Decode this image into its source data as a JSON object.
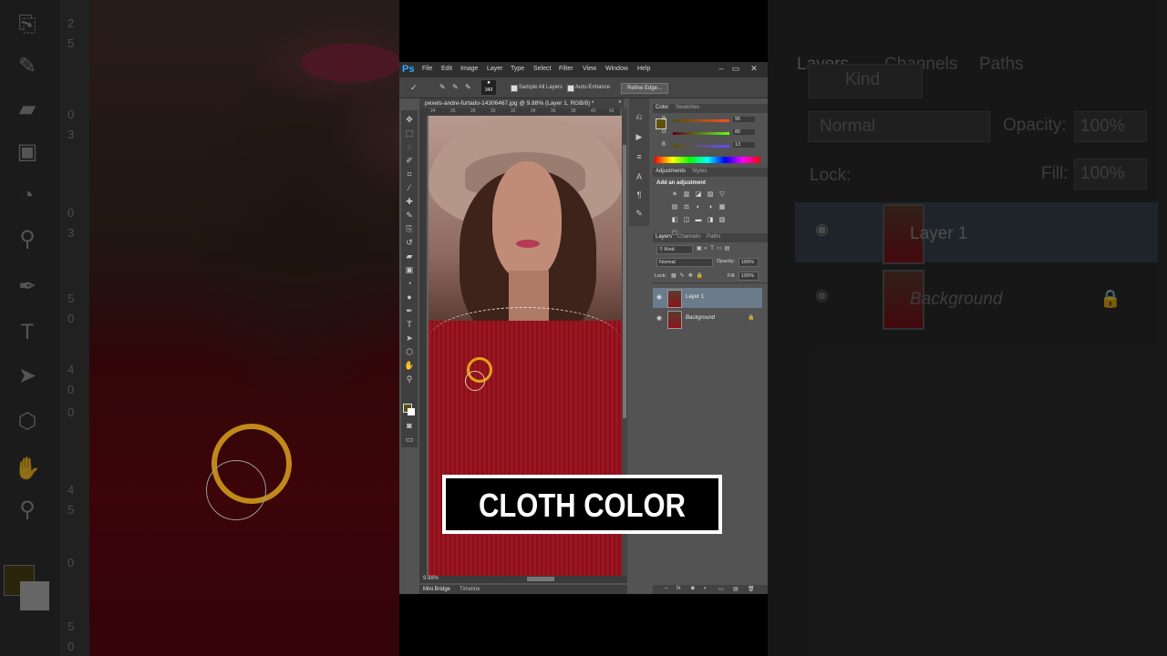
{
  "window": {
    "app_logo": "Ps",
    "menu": [
      "File",
      "Edit",
      "Image",
      "Layer",
      "Type",
      "Select",
      "Filter",
      "View",
      "Window",
      "Help"
    ]
  },
  "options_bar": {
    "brush_size": "343",
    "sample_all_layers": "Sample All Layers",
    "auto_enhance": "Auto-Enhance",
    "refine_edge": "Refine Edge..."
  },
  "document": {
    "tab_title": "pexels-andre-furtado-14306467.jpg @ 9.88% (Layer 1, RGB/8) *",
    "close": "×",
    "ruler_ticks": [
      "24",
      "26",
      "28",
      "30",
      "32",
      "34",
      "36",
      "38",
      "40",
      "42"
    ],
    "zoom": "9.88%"
  },
  "bottom_tabs": {
    "mini_bridge": "Mini Bridge",
    "timeline": "Timeline"
  },
  "color_panel": {
    "tabs": [
      "Color",
      "Swatches"
    ],
    "channels": [
      {
        "label": "R",
        "value": "95",
        "gradient": "linear-gradient(90deg,#505018,#ff5018)"
      },
      {
        "label": "G",
        "value": "80",
        "gradient": "linear-gradient(90deg,#5f0018,#5fff18)"
      },
      {
        "label": "B",
        "value": "13",
        "gradient": "linear-gradient(90deg,#5f5000,#5f50ff)"
      }
    ],
    "foreground": "#5f500d"
  },
  "adjustments_panel": {
    "tabs": [
      "Adjustments",
      "Styles"
    ],
    "heading": "Add an adjustment",
    "icons": [
      "☀",
      "▥",
      "◪",
      "▨",
      "▽",
      "▤",
      "⚖",
      "◐",
      "◑",
      "▦",
      "◧",
      "◫",
      "▬",
      "◨",
      "▧",
      "◻"
    ]
  },
  "layers_panel": {
    "tabs": [
      "Layers",
      "Channels",
      "Paths"
    ],
    "kind": "Kind",
    "blend_mode": "Normal",
    "opacity_label": "Opacity:",
    "opacity": "100%",
    "lock_label": "Lock:",
    "fill_label": "Fill:",
    "fill": "100%",
    "layers": [
      {
        "name": "Layer 1",
        "selected": true
      },
      {
        "name": "Background",
        "selected": false
      }
    ],
    "footer_icons": [
      "⇔",
      "fx",
      "◙",
      "◐",
      "▭",
      "▤",
      "🗑"
    ]
  },
  "caption": {
    "text": "CLOTH COLOR"
  },
  "bg_left": {
    "ruler_marks": [
      "2",
      "5",
      "0",
      "3",
      "0",
      "3",
      "5",
      "0",
      "4",
      "0",
      "0",
      "4",
      "5",
      "0",
      "5",
      "0"
    ]
  },
  "bg_right": {
    "tabs": [
      "Layers",
      "Channels",
      "Paths"
    ],
    "kind": "Kind",
    "blend_mode": "Normal",
    "opacity_label": "Opacity:",
    "opacity": "100%",
    "lock_label": "Lock:",
    "fill_label": "Fill:",
    "fill": "100%",
    "layer1": "Layer 1",
    "background": "Background"
  }
}
